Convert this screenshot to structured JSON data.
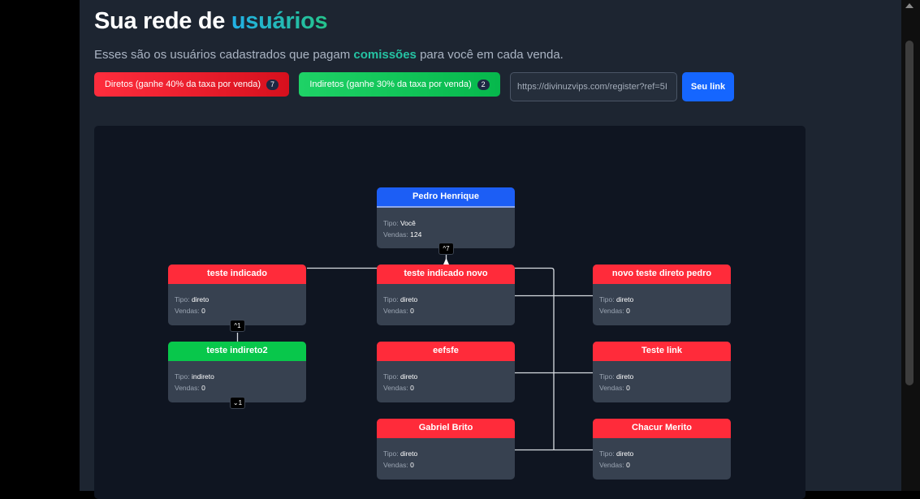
{
  "header": {
    "title_main": "Sua rede de ",
    "title_accent": "usuários",
    "subtitle_before": "Esses são os usuários cadastrados que pagam ",
    "subtitle_accent": "comissões",
    "subtitle_after": " para você em cada venda."
  },
  "filters": {
    "direct_label": "Diretos (ganhe 40% da taxa por venda)",
    "direct_count": "7",
    "indirect_label": "Indiretos (ganhe 30% da taxa por venda)",
    "indirect_count": "2"
  },
  "referral": {
    "link_value": "https://divinuzvips.com/register?ref=5I",
    "button_label": "Seu link"
  },
  "labels": {
    "type": "Tipo:",
    "sales": "Vendas:"
  },
  "nodes": [
    {
      "name": "Pedro Henrique",
      "type": "Você",
      "sales": "124"
    },
    {
      "name": "teste indicado",
      "type": "direto",
      "sales": "0"
    },
    {
      "name": "teste indicado novo",
      "type": "direto",
      "sales": "0"
    },
    {
      "name": "novo teste direto pedro",
      "type": "direto",
      "sales": "0"
    },
    {
      "name": "teste indireto2",
      "type": "indireto",
      "sales": "0"
    },
    {
      "name": "eefsfe",
      "type": "direto",
      "sales": "0"
    },
    {
      "name": "Teste link",
      "type": "direto",
      "sales": "0"
    },
    {
      "name": "Gabriel Brito",
      "type": "direto",
      "sales": "0"
    },
    {
      "name": "Chacur Merito",
      "type": "direto",
      "sales": "0"
    }
  ],
  "toggles": {
    "root_children": "^7",
    "teste_indicado_children": "^1",
    "teste_indireto2_children": "⌄1"
  },
  "colors": {
    "self": "#1c5ef5",
    "direct": "#ff2b3a",
    "indirect": "#08c74b",
    "accent_blue": "#22b0e6",
    "accent_green": "#25c38b",
    "link_button": "#1566ff"
  }
}
